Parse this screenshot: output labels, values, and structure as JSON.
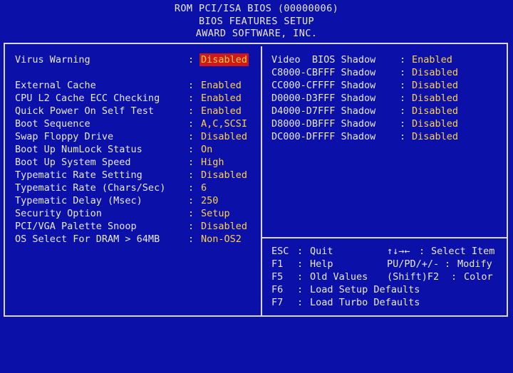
{
  "header": {
    "line1": "ROM PCI/ISA BIOS (00000006)",
    "line2": "BIOS FEATURES SETUP",
    "line3": "AWARD SOFTWARE, INC."
  },
  "left_settings": [
    {
      "label": "Virus Warning",
      "value": "Disabled",
      "selected": true
    },
    {
      "label": "External Cache",
      "value": "Enabled"
    },
    {
      "label": "CPU L2 Cache ECC Checking",
      "value": "Enabled"
    },
    {
      "label": "Quick Power On Self Test",
      "value": "Enabled"
    },
    {
      "label": "Boot Sequence",
      "value": "A,C,SCSI"
    },
    {
      "label": "Swap Floppy Drive",
      "value": "Disabled"
    },
    {
      "label": "Boot Up NumLock Status",
      "value": "On"
    },
    {
      "label": "Boot Up System Speed",
      "value": "High"
    },
    {
      "label": "Typematic Rate Setting",
      "value": "Disabled"
    },
    {
      "label": "Typematic Rate (Chars/Sec)",
      "value": "6"
    },
    {
      "label": "Typematic Delay (Msec)",
      "value": "250"
    },
    {
      "label": "Security Option",
      "value": "Setup"
    },
    {
      "label": "PCI/VGA Palette Snoop",
      "value": "Disabled"
    },
    {
      "label": "OS Select For DRAM > 64MB",
      "value": "Non-OS2"
    }
  ],
  "right_settings": [
    {
      "label": "Video  BIOS Shadow",
      "value": "Enabled"
    },
    {
      "label": "C8000-CBFFF Shadow",
      "value": "Disabled"
    },
    {
      "label": "CC000-CFFFF Shadow",
      "value": "Disabled"
    },
    {
      "label": "D0000-D3FFF Shadow",
      "value": "Disabled"
    },
    {
      "label": "D4000-D7FFF Shadow",
      "value": "Disabled"
    },
    {
      "label": "D8000-DBFFF Shadow",
      "value": "Disabled"
    },
    {
      "label": "DC000-DFFFF Shadow",
      "value": "Disabled"
    }
  ],
  "keys": [
    {
      "key": "ESC",
      "action": "Quit",
      "key2": "↑↓→←",
      "action2": "Select Item"
    },
    {
      "key": "F1",
      "action": "Help",
      "key2": "PU/PD/+/-",
      "action2": "Modify"
    },
    {
      "key": "F5",
      "action": "Old Values",
      "key2": "(Shift)F2",
      "action2": "Color"
    },
    {
      "key": "F6",
      "action": "Load Setup Defaults",
      "key2": "",
      "action2": ""
    },
    {
      "key": "F7",
      "action": "Load Turbo Defaults",
      "key2": "",
      "action2": ""
    }
  ],
  "colors": {
    "background": "#0b10a8",
    "text": "#e8e8e8",
    "value": "#ffd24a",
    "highlight": "#d01818"
  }
}
